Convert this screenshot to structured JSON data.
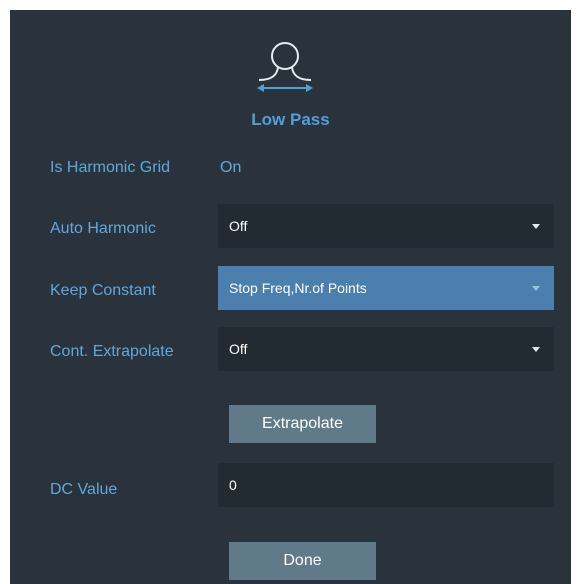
{
  "header": {
    "icon": "low-pass-filter-icon",
    "title": "Low Pass"
  },
  "rows": {
    "harmonic_grid": {
      "label": "Is Harmonic Grid",
      "value": "On"
    },
    "auto_harmonic": {
      "label": "Auto Harmonic",
      "value": "Off"
    },
    "keep_constant": {
      "label": "Keep Constant",
      "value": "Stop Freq,Nr.of Points"
    },
    "cont_extrapolate": {
      "label": "Cont. Extrapolate",
      "value": "Off"
    },
    "dc_value": {
      "label": "DC Value",
      "value": "0"
    }
  },
  "buttons": {
    "extrapolate": "Extrapolate",
    "done": "Done"
  },
  "colors": {
    "panel_bg": "#2a333b",
    "field_bg": "#232b32",
    "label_blue": "#5fa7de",
    "selected_field": "#4b7fae",
    "button_bg": "#607a8a"
  }
}
